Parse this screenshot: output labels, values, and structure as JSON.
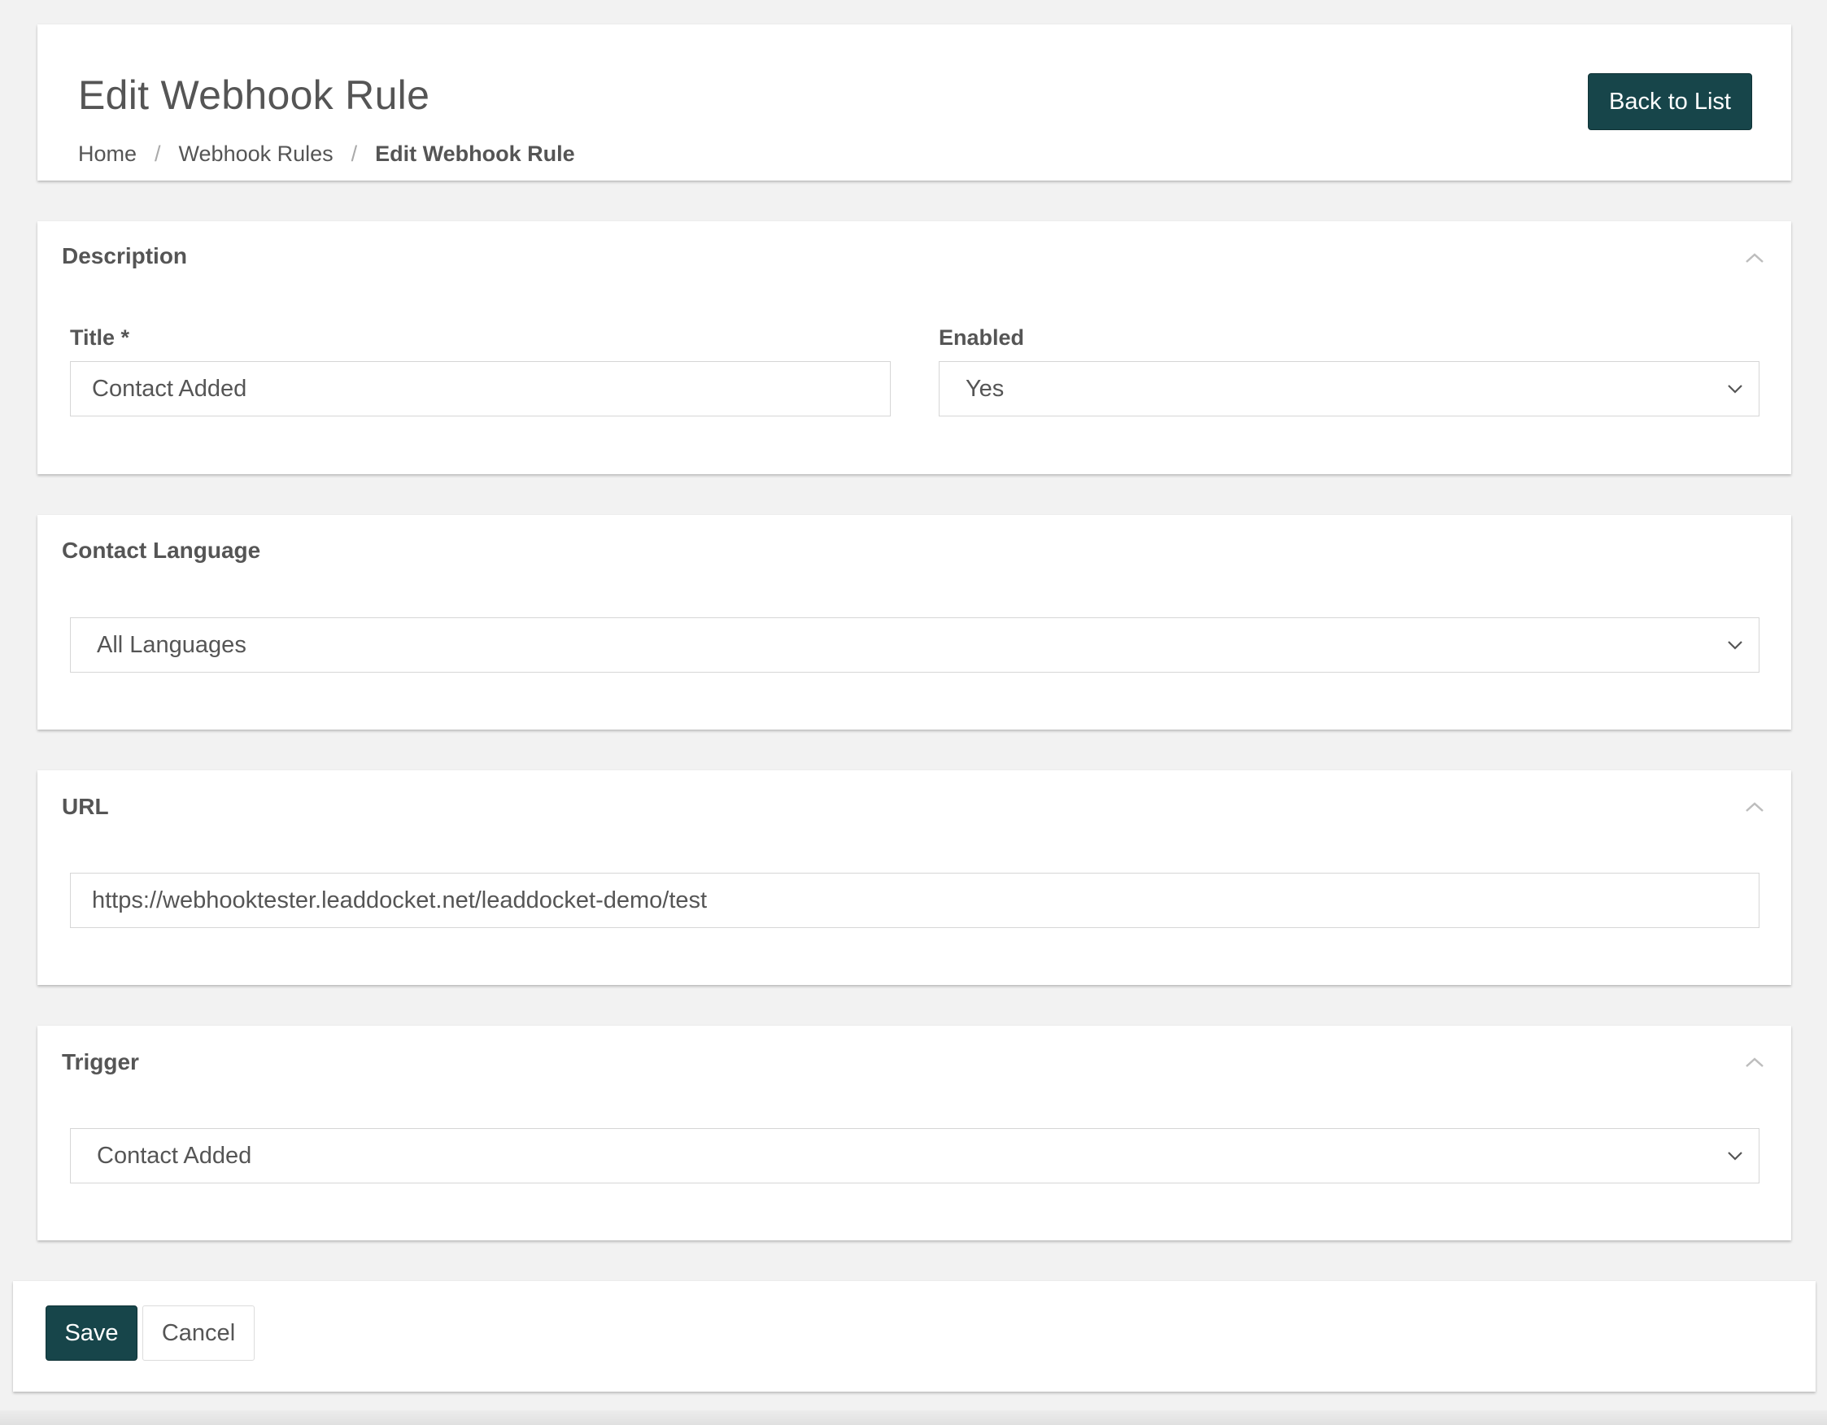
{
  "header": {
    "title": "Edit Webhook Rule",
    "breadcrumb": [
      "Home",
      "Webhook Rules",
      "Edit Webhook Rule"
    ],
    "breadcrumb_separator": "/",
    "back_button_label": "Back to List"
  },
  "description": {
    "heading": "Description",
    "title_label": "Title *",
    "title_value": "Contact Added",
    "enabled_label": "Enabled",
    "enabled_value": "Yes"
  },
  "language": {
    "heading": "Contact Language",
    "value": "All Languages"
  },
  "url": {
    "heading": "URL",
    "value": "https://webhooktester.leaddocket.net/leaddocket-demo/test"
  },
  "trigger": {
    "heading": "Trigger",
    "value": "Contact Added"
  },
  "footer": {
    "save_label": "Save",
    "cancel_label": "Cancel"
  },
  "icons": {
    "collapse": "chevron-up-icon",
    "select_caret": "chevron-down-icon"
  },
  "colors": {
    "primary_button": "#17454a",
    "page_background": "#f2f2f2",
    "card_background": "#ffffff",
    "text": "#555555"
  }
}
